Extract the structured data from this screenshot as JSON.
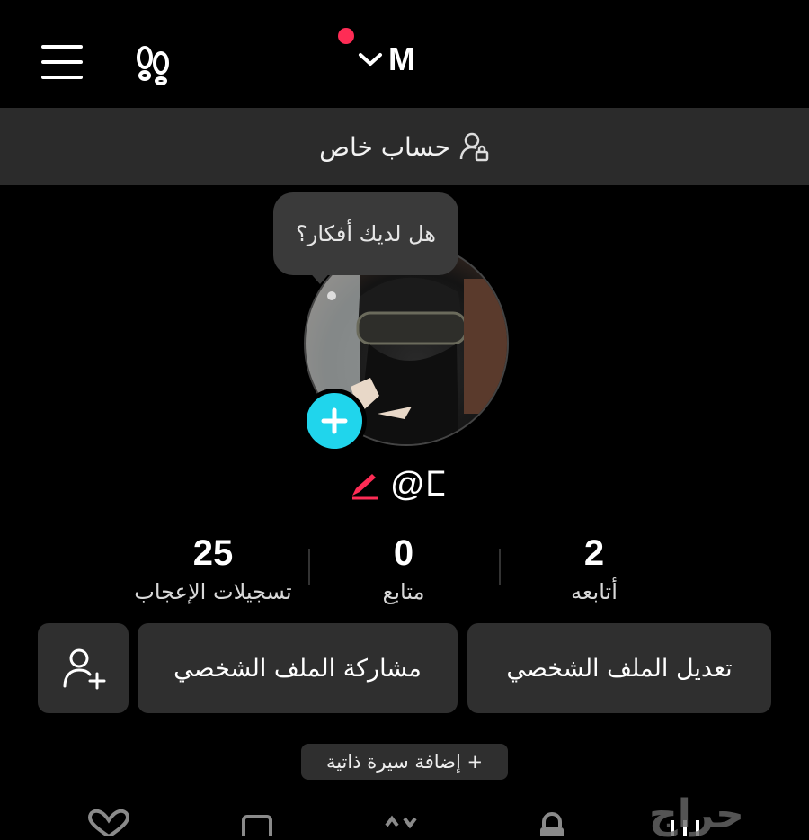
{
  "header": {
    "account_name": "M",
    "has_notification": true
  },
  "private_banner": {
    "text": "حساب خاص"
  },
  "profile": {
    "bubble_text": "هل لديك أفكار؟",
    "username": "@ⵎ"
  },
  "stats": [
    {
      "value": "2",
      "label": "أتابعه"
    },
    {
      "value": "0",
      "label": "متابع"
    },
    {
      "value": "25",
      "label": "تسجيلات الإعجاب"
    }
  ],
  "actions": {
    "edit_profile": "تعديل الملف الشخصي",
    "share_profile": "مشاركة الملف الشخصي",
    "add_bio": "+ إضافة سيرة ذاتية"
  },
  "watermark": "حراج",
  "colors": {
    "accent_red": "#fe2c55",
    "story_cyan": "#20d5ec",
    "surface": "#2f2f2f",
    "banner": "#2b2b2b"
  },
  "icons": [
    "menu-icon",
    "footprint-icon",
    "chevron-down-icon",
    "private-account-icon",
    "plus-icon",
    "edit-pencil-icon",
    "add-friend-icon",
    "liked-tab-icon",
    "grid-tab-icon",
    "repost-tab-icon",
    "lock-tab-icon",
    "videos-tab-icon"
  ]
}
